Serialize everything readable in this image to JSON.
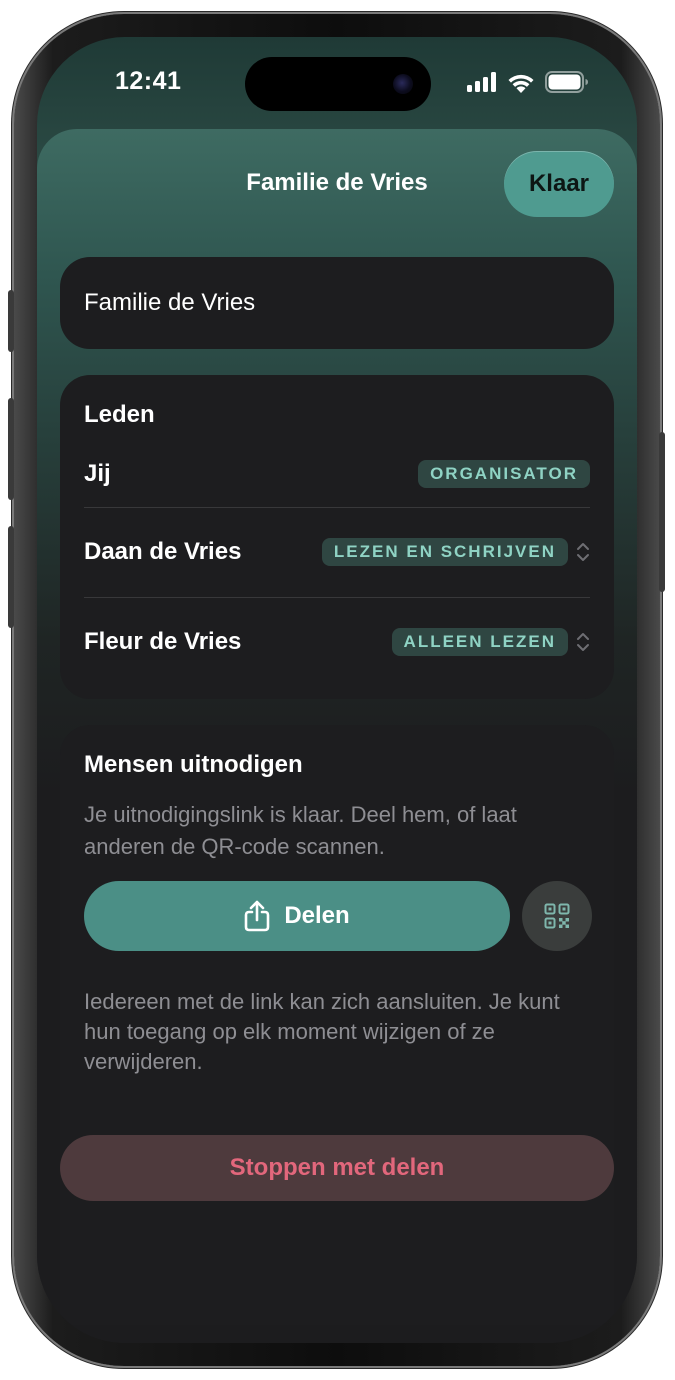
{
  "status_bar": {
    "time": "12:41"
  },
  "nav": {
    "title": "Familie de Vries",
    "done_label": "Klaar"
  },
  "name_field": {
    "value": "Familie de Vries"
  },
  "members": {
    "title": "Leden",
    "items": [
      {
        "name": "Jij",
        "role": "ORGANISATOR",
        "editable": false
      },
      {
        "name": "Daan de Vries",
        "role": "LEZEN EN SCHRIJVEN",
        "editable": true
      },
      {
        "name": "Fleur de Vries",
        "role": "ALLEEN LEZEN",
        "editable": true
      }
    ]
  },
  "invite": {
    "title": "Mensen uitnodigen",
    "description": "Je uitnodigingslink is klaar. Deel hem, of laat anderen de QR-code scannen.",
    "share_label": "Delen",
    "footnote": "Iedereen met de link kan zich aansluiten. Je kunt hun toegang op elk moment wijzigen of ze verwijderen."
  },
  "stop_sharing_label": "Stoppen met delen",
  "colors": {
    "accent": "#4f9b90",
    "badge_text": "#8fd3c4",
    "destructive": "#e2677c",
    "card_bg": "#1d1d1f"
  }
}
